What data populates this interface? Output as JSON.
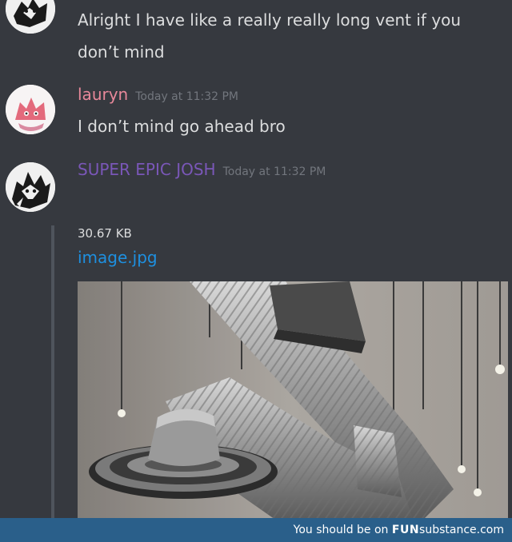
{
  "messages": [
    {
      "line1": "Alright I have like a really really long vent if you",
      "line2": "don’t mind"
    },
    {
      "username": "lauryn",
      "timestamp": "Today at 11:32 PM",
      "text": "I don’t mind go ahead bro"
    },
    {
      "username": "SUPER EPIC JOSH",
      "timestamp": "Today at 11:32 PM"
    }
  ],
  "attachment": {
    "filesize": "30.67 KB",
    "filename": "image.jpg"
  },
  "footer": {
    "prefix": "You should be on",
    "brand_bold": "FUN",
    "brand_rest": "substance.com"
  },
  "colors": {
    "background": "#36393f",
    "username_lauryn": "#e8889a",
    "username_josh": "#7a57b8",
    "link": "#1e90e0",
    "footer": "#2a5f8a"
  },
  "icons": {
    "avatar_top": "josh-avatar-icon",
    "avatar_lauryn": "lauryn-avatar-icon",
    "avatar_josh": "josh-avatar-icon"
  }
}
